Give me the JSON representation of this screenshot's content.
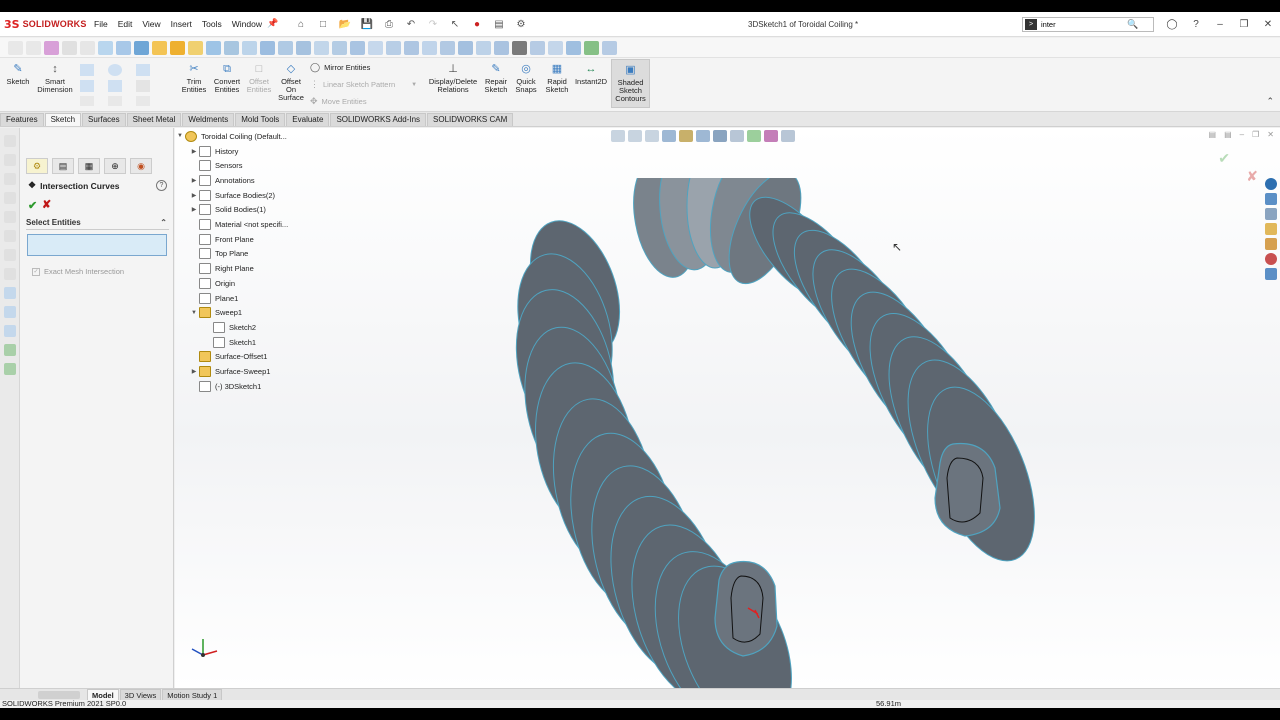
{
  "app": {
    "logo_text": "SOLIDWORKS",
    "doc_title": "3DSketch1 of Toroidal Coiling *",
    "search_value": "inter"
  },
  "menu": [
    "File",
    "Edit",
    "View",
    "Insert",
    "Tools",
    "Window"
  ],
  "command_manager": {
    "sketch": "Sketch",
    "smart_dimension": [
      "Smart",
      "Dimension"
    ],
    "trim": [
      "Trim",
      "Entities"
    ],
    "convert": [
      "Convert",
      "Entities"
    ],
    "offset": [
      "Offset",
      "Entities"
    ],
    "offset_surface": [
      "Offset",
      "On",
      "Surface"
    ],
    "mirror": "Mirror Entities",
    "linear_pattern": "Linear Sketch Pattern",
    "move": "Move Entities",
    "display_delete": [
      "Display/Delete",
      "Relations"
    ],
    "repair": [
      "Repair",
      "Sketch"
    ],
    "quick_snaps": [
      "Quick",
      "Snaps"
    ],
    "rapid_sketch": [
      "Rapid",
      "Sketch"
    ],
    "instant2d": "Instant2D",
    "shaded": [
      "Shaded",
      "Sketch",
      "Contours"
    ]
  },
  "tabs": [
    "Features",
    "Sketch",
    "Surfaces",
    "Sheet Metal",
    "Weldments",
    "Mold Tools",
    "Evaluate",
    "SOLIDWORKS Add-Ins",
    "SOLIDWORKS CAM"
  ],
  "active_tab": "Sketch",
  "property_manager": {
    "title": "Intersection Curves",
    "help": "?",
    "group_label": "Select Entities",
    "checkbox_label": "Exact Mesh Intersection"
  },
  "feature_tree": {
    "root": "Toroidal Coiling  (Default...",
    "items": [
      {
        "label": "History",
        "expand": true
      },
      {
        "label": "Sensors",
        "expand": false
      },
      {
        "label": "Annotations",
        "expand": true
      },
      {
        "label": "Surface Bodies(2)",
        "expand": true
      },
      {
        "label": "Solid Bodies(1)",
        "expand": true
      },
      {
        "label": "Material <not specifi...",
        "expand": false
      },
      {
        "label": "Front Plane",
        "expand": false
      },
      {
        "label": "Top Plane",
        "expand": false
      },
      {
        "label": "Right Plane",
        "expand": false
      },
      {
        "label": "Origin",
        "expand": false
      },
      {
        "label": "Plane1",
        "expand": false
      },
      {
        "label": "Sweep1",
        "expand": true,
        "open": true
      },
      {
        "label": "Sketch2",
        "child": true
      },
      {
        "label": "Sketch1",
        "child": true
      },
      {
        "label": "Surface-Offset1",
        "expand": false
      },
      {
        "label": "Surface-Sweep1",
        "expand": true
      },
      {
        "label": "(-) 3DSketch1",
        "expand": false
      }
    ]
  },
  "bottom_tabs": [
    "Model",
    "3D Views",
    "Motion Study 1"
  ],
  "status": {
    "left": "SOLIDWORKS Premium 2021 SP0.0",
    "right": "56.91m"
  },
  "colors": {
    "brand_red": "#c41e1e",
    "model_fill": "#5d6670",
    "model_edge": "#4fa3c0",
    "selection_blue": "#d9ebf7"
  }
}
